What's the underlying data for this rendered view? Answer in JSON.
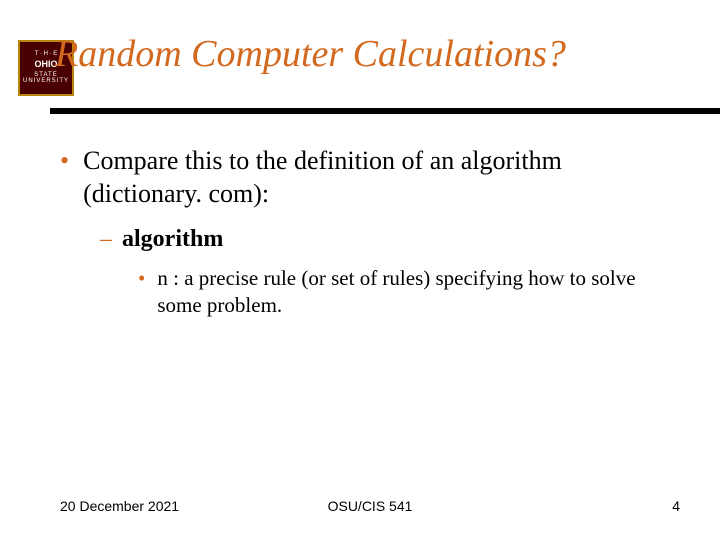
{
  "logo": {
    "top_text": "T · H · E",
    "ohio": "OHIO",
    "state": "STATE",
    "university": "UNIVERSITY"
  },
  "title": "Random Computer Calculations?",
  "bullets": {
    "l1_text": "Compare this to the definition of an algorithm (dictionary. com):",
    "l2_text": "algorithm",
    "l3_text": "n : a precise rule (or set of rules) specifying how to solve some problem."
  },
  "markers": {
    "dot": "•",
    "dash": "–"
  },
  "footer": {
    "date": "20 December 2021",
    "center": "OSU/CIS 541",
    "page": "4"
  }
}
